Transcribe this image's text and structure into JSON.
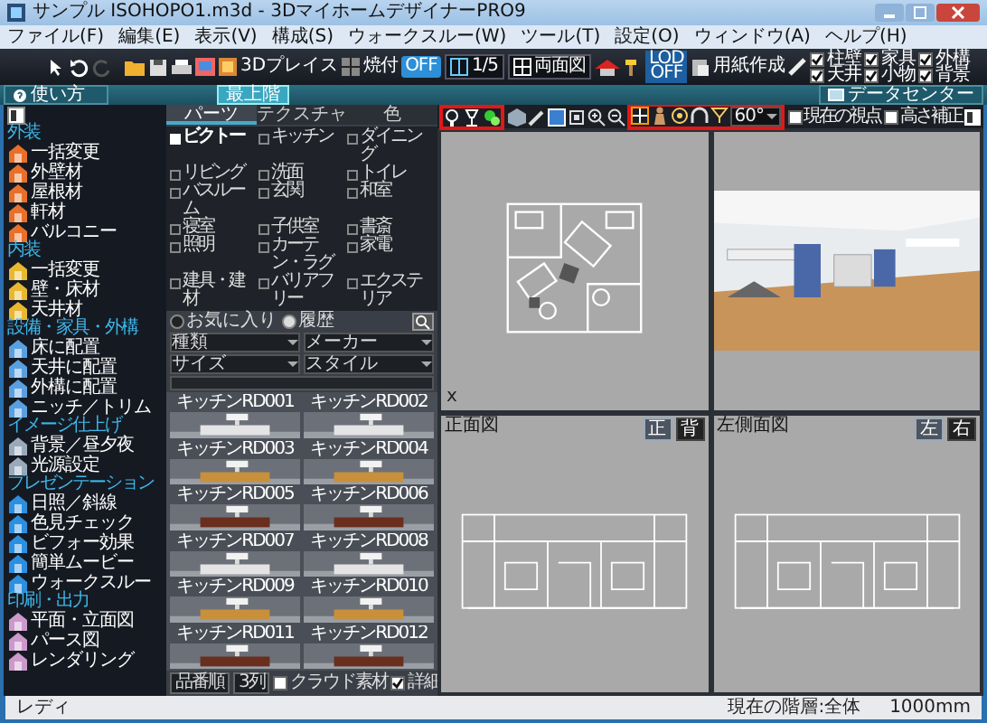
{
  "window": {
    "title": "サンプル ISOHOPO1.m3d - 3DマイホームデザイナーPRO9"
  },
  "menu": [
    "ファイル(F)",
    "編集(E)",
    "表示(V)",
    "構成(S)",
    "ウォークスルー(W)",
    "ツール(T)",
    "設定(O)",
    "ウィンドウ(A)",
    "ヘルプ(H)"
  ],
  "toolbar": {
    "place_label": "3Dプレイス",
    "bake": {
      "label": "焼付",
      "state": "OFF"
    },
    "scale": "1/5",
    "view_mode": "両面図",
    "lod": {
      "label": "LOD",
      "state": "OFF"
    },
    "paper_label": "用紙作成",
    "toggles": [
      {
        "label": "柱壁",
        "checked": true
      },
      {
        "label": "家具",
        "checked": true
      },
      {
        "label": "外構",
        "checked": true
      },
      {
        "label": "天井",
        "checked": true
      },
      {
        "label": "小物",
        "checked": true
      },
      {
        "label": "背景",
        "checked": true
      }
    ]
  },
  "floor_bar": {
    "help": "使い方",
    "tabs": [
      {
        "label": "最上階",
        "selected": true
      }
    ],
    "data_center": "データセンター"
  },
  "sidebar": {
    "sections": [
      {
        "title": "外装",
        "items": [
          "一括変更",
          "外壁材",
          "屋根材",
          "軒材",
          "バルコニー"
        ]
      },
      {
        "title": "内装",
        "items": [
          "一括変更",
          "壁・床材",
          "天井材"
        ]
      },
      {
        "title": "設備・家具・外構",
        "items": [
          "床に配置",
          "天井に配置",
          "外構に配置",
          "ニッチ／トリム"
        ]
      },
      {
        "title": "イメージ仕上げ",
        "items": [
          "背景／昼夕夜",
          "光源設定"
        ]
      },
      {
        "title": "プレゼンテーション",
        "items": [
          "日照／斜線",
          "色見チェック",
          "ビフォー効果",
          "簡単ムービー",
          "ウォークスルー"
        ]
      },
      {
        "title": "印刷・出力",
        "items": [
          "平面・立面図",
          "パース図",
          "レンダリング"
        ]
      }
    ]
  },
  "parts_panel": {
    "tabs": [
      {
        "label": "パーツ",
        "selected": true
      },
      {
        "label": "テクスチャ",
        "selected": false
      },
      {
        "label": "色",
        "selected": false
      }
    ],
    "categories": [
      {
        "label": "ビクトー",
        "selected": true
      },
      {
        "label": "キッチン",
        "selected": false
      },
      {
        "label": "ダイニング",
        "selected": false
      },
      {
        "label": "リビング",
        "selected": false
      },
      {
        "label": "洗面",
        "selected": false
      },
      {
        "label": "トイレ",
        "selected": false
      },
      {
        "label": "バスルーム",
        "selected": false
      },
      {
        "label": "玄関",
        "selected": false
      },
      {
        "label": "和室",
        "selected": false
      },
      {
        "label": "寝室",
        "selected": false
      },
      {
        "label": "子供室",
        "selected": false
      },
      {
        "label": "書斎",
        "selected": false
      },
      {
        "label": "照明",
        "selected": false
      },
      {
        "label": "カーテン・ラグ",
        "selected": false
      },
      {
        "label": "家電",
        "selected": false
      },
      {
        "label": "建具・建材",
        "selected": false
      },
      {
        "label": "バリアフリー",
        "selected": false
      },
      {
        "label": "エクステリア",
        "selected": false
      }
    ],
    "filters": [
      {
        "label": "お気に入り",
        "selected": false
      },
      {
        "label": "履歴",
        "selected": true
      }
    ],
    "dropdowns": [
      "種類",
      "メーカー",
      "サイズ",
      "スタイル"
    ],
    "items": [
      {
        "label": "キッチンRD001",
        "color": "#e4e4e4"
      },
      {
        "label": "キッチンRD002",
        "color": "#e4e4e4"
      },
      {
        "label": "キッチンRD003",
        "color": "#c8903a"
      },
      {
        "label": "キッチンRD004",
        "color": "#c8903a"
      },
      {
        "label": "キッチンRD005",
        "color": "#6a2e1e"
      },
      {
        "label": "キッチンRD006",
        "color": "#6a2e1e"
      },
      {
        "label": "キッチンRD007",
        "color": "#e4e4e4"
      },
      {
        "label": "キッチンRD008",
        "color": "#e4e4e4"
      },
      {
        "label": "キッチンRD009",
        "color": "#c8903a"
      },
      {
        "label": "キッチンRD010",
        "color": "#c8903a"
      },
      {
        "label": "キッチンRD011",
        "color": "#6a2e1e"
      },
      {
        "label": "キッチンRD012",
        "color": "#6a2e1e"
      }
    ],
    "footer": {
      "sort": "品番順",
      "columns": "3列",
      "options": [
        {
          "label": "クラウド素材",
          "checked": false
        },
        {
          "label": "詳細",
          "checked": true
        }
      ]
    }
  },
  "viewport": {
    "angle": "60°",
    "options": [
      {
        "label": "現在の視点",
        "checked": false
      },
      {
        "label": "高さ補正",
        "checked": false
      }
    ],
    "panes": [
      {
        "kind": "plan",
        "axis": "x"
      },
      {
        "kind": "perspective"
      },
      {
        "kind": "elevation",
        "title": "正面図",
        "buttons": [
          {
            "label": "正",
            "selected": true
          },
          {
            "label": "背",
            "selected": false
          }
        ]
      },
      {
        "kind": "elevation",
        "title": "左側面図",
        "buttons": [
          {
            "label": "左",
            "selected": true
          },
          {
            "label": "右",
            "selected": false
          }
        ]
      }
    ]
  },
  "status_bar": {
    "message": "レディ",
    "layer": "現在の階層:全体",
    "unit": "1000mm"
  }
}
